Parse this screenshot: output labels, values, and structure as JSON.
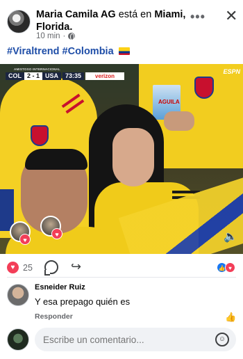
{
  "header": {
    "author": "Maria Camila AG",
    "verb": "está en",
    "location": "Miami, Florida",
    "time": "10 min",
    "privacy_icon": "globe-icon",
    "more_icon": "more-horizontal-icon",
    "close_icon": "close-icon"
  },
  "caption": {
    "hashtag1": "#Viraltrend",
    "hashtag2": "#Colombia"
  },
  "video": {
    "competition": "AMISTOSO INTERNACIONAL",
    "team_home": "COL",
    "score": "2 - 1",
    "team_away": "USA",
    "clock": "73:35",
    "sponsor": "verizon",
    "network": "ESPN",
    "cup_text": "AGUILA",
    "volume_icon": "volume-icon"
  },
  "reactions": {
    "count": "25",
    "heart_icon": "heart-reaction-icon",
    "comment_icon": "comment-icon",
    "share_icon": "share-icon"
  },
  "comment": {
    "author": "Esneider Ruiz",
    "text": "Y esa prepago quién es",
    "reply_label": "Responder"
  },
  "composer": {
    "placeholder": "Escribe un comentario..."
  },
  "colors": {
    "hashtag": "#1f4ea8",
    "heart": "#f33e58",
    "like": "#1877f2",
    "jersey_yellow": "#f0cb1a"
  }
}
